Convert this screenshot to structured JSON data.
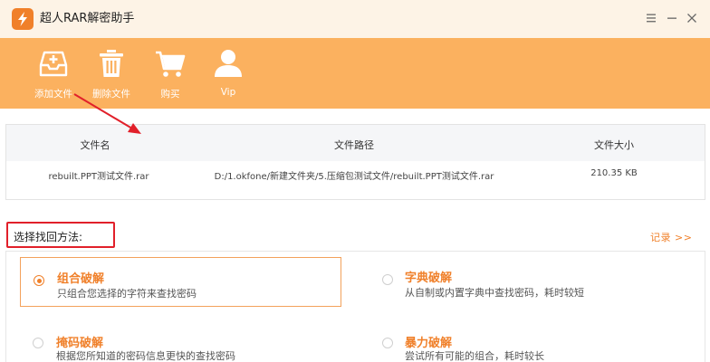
{
  "window": {
    "title": "超人RAR解密助手"
  },
  "toolbar": {
    "items": [
      {
        "label": "添加文件",
        "icon": "add-file-icon"
      },
      {
        "label": "删除文件",
        "icon": "trash-icon"
      },
      {
        "label": "购买",
        "icon": "cart-icon"
      },
      {
        "label": "Vip",
        "icon": "user-icon"
      }
    ]
  },
  "file_table": {
    "headers": {
      "name": "文件名",
      "path": "文件路径",
      "size": "文件大小"
    },
    "rows": [
      {
        "name": "rebuilt.PPT测试文件.rar",
        "path": "D:/1.okfone/新建文件夹/5.压缩包测试文件/rebuilt.PPT测试文件.rar",
        "size": "210.35 KB"
      }
    ]
  },
  "method": {
    "title": "选择找回方法:",
    "history_link": "记录 >>",
    "options": [
      {
        "title": "组合破解",
        "desc": "只组合您选择的字符来查找密码",
        "selected": true
      },
      {
        "title": "字典破解",
        "desc": "从自制或内置字典中查找密码，耗时较短",
        "selected": false
      },
      {
        "title": "掩码破解",
        "desc": "根据您所知道的密码信息更快的查找密码",
        "selected": false
      },
      {
        "title": "暴力破解",
        "desc": "尝试所有可能的组合，耗时较长",
        "selected": false
      }
    ]
  },
  "colors": {
    "accent": "#f0802a",
    "toolbar": "#fbb15f",
    "titlebar": "#fdf3e6",
    "annotation": "#e1202a"
  }
}
